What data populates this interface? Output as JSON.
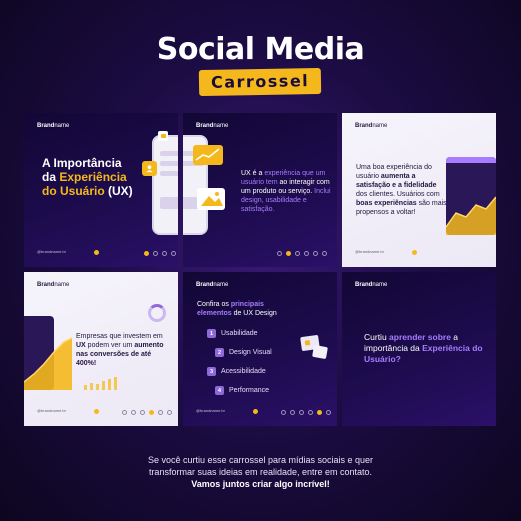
{
  "header": {
    "title": "Social Media",
    "subtitle": "Carrossel"
  },
  "brand": {
    "part1": "Brand",
    "part2": "name"
  },
  "cards": {
    "c1": {
      "line1": "A Importância",
      "line2a": "da ",
      "line2b": "Experiência",
      "line3a": "do Usuário",
      "line3b": " (UX)",
      "footer": "@brandname.br"
    },
    "c2": {
      "t1": "UX é a ",
      "t2": "experiência que um usuário tem",
      "t3": " ao interagir com um produto ou serviço. ",
      "t4": "Inclui design, usabilidade e satisfação."
    },
    "c3": {
      "t1": "Uma boa experiência do usuário ",
      "t2": "aumenta a satisfação e a fidelidade",
      "t3": " dos clientes. Usuários com ",
      "t4": "boas experiências",
      "t5": " são mais propensos a voltar!",
      "footer": "@brandname.br"
    },
    "c4": {
      "t1": "Empresas que investem em ",
      "t2": "UX",
      "t3": " podem ver um ",
      "t4": "aumento nas conversões de até 400%!",
      "footer": "@brandname.br"
    },
    "c5": {
      "t1": "Confira os ",
      "t2": "principais elementos",
      "t3": " de UX Design",
      "items": [
        {
          "num": "1",
          "label": "Usabilidade"
        },
        {
          "num": "2",
          "label": "Design Visual"
        },
        {
          "num": "3",
          "label": "Acessibilidade"
        },
        {
          "num": "4",
          "label": "Performance"
        }
      ],
      "footer": "@brandname.br"
    },
    "c6": {
      "t1": "Curtiu ",
      "t2": "aprender sobre",
      "t3": " a importância da ",
      "t4": "Experiência do Usuário?"
    }
  },
  "bottom": {
    "line1": "Se você curtiu esse carrossel para mídias sociais e quer",
    "line2": "transformar suas ideias em realidade, entre em contato.",
    "line3": "Vamos juntos criar algo incrível!"
  },
  "colors": {
    "accent_yellow": "#f5b81c",
    "accent_purple": "#a77cff",
    "dark_bg": "#1e0c50",
    "light_bg": "#f4f1f9"
  }
}
